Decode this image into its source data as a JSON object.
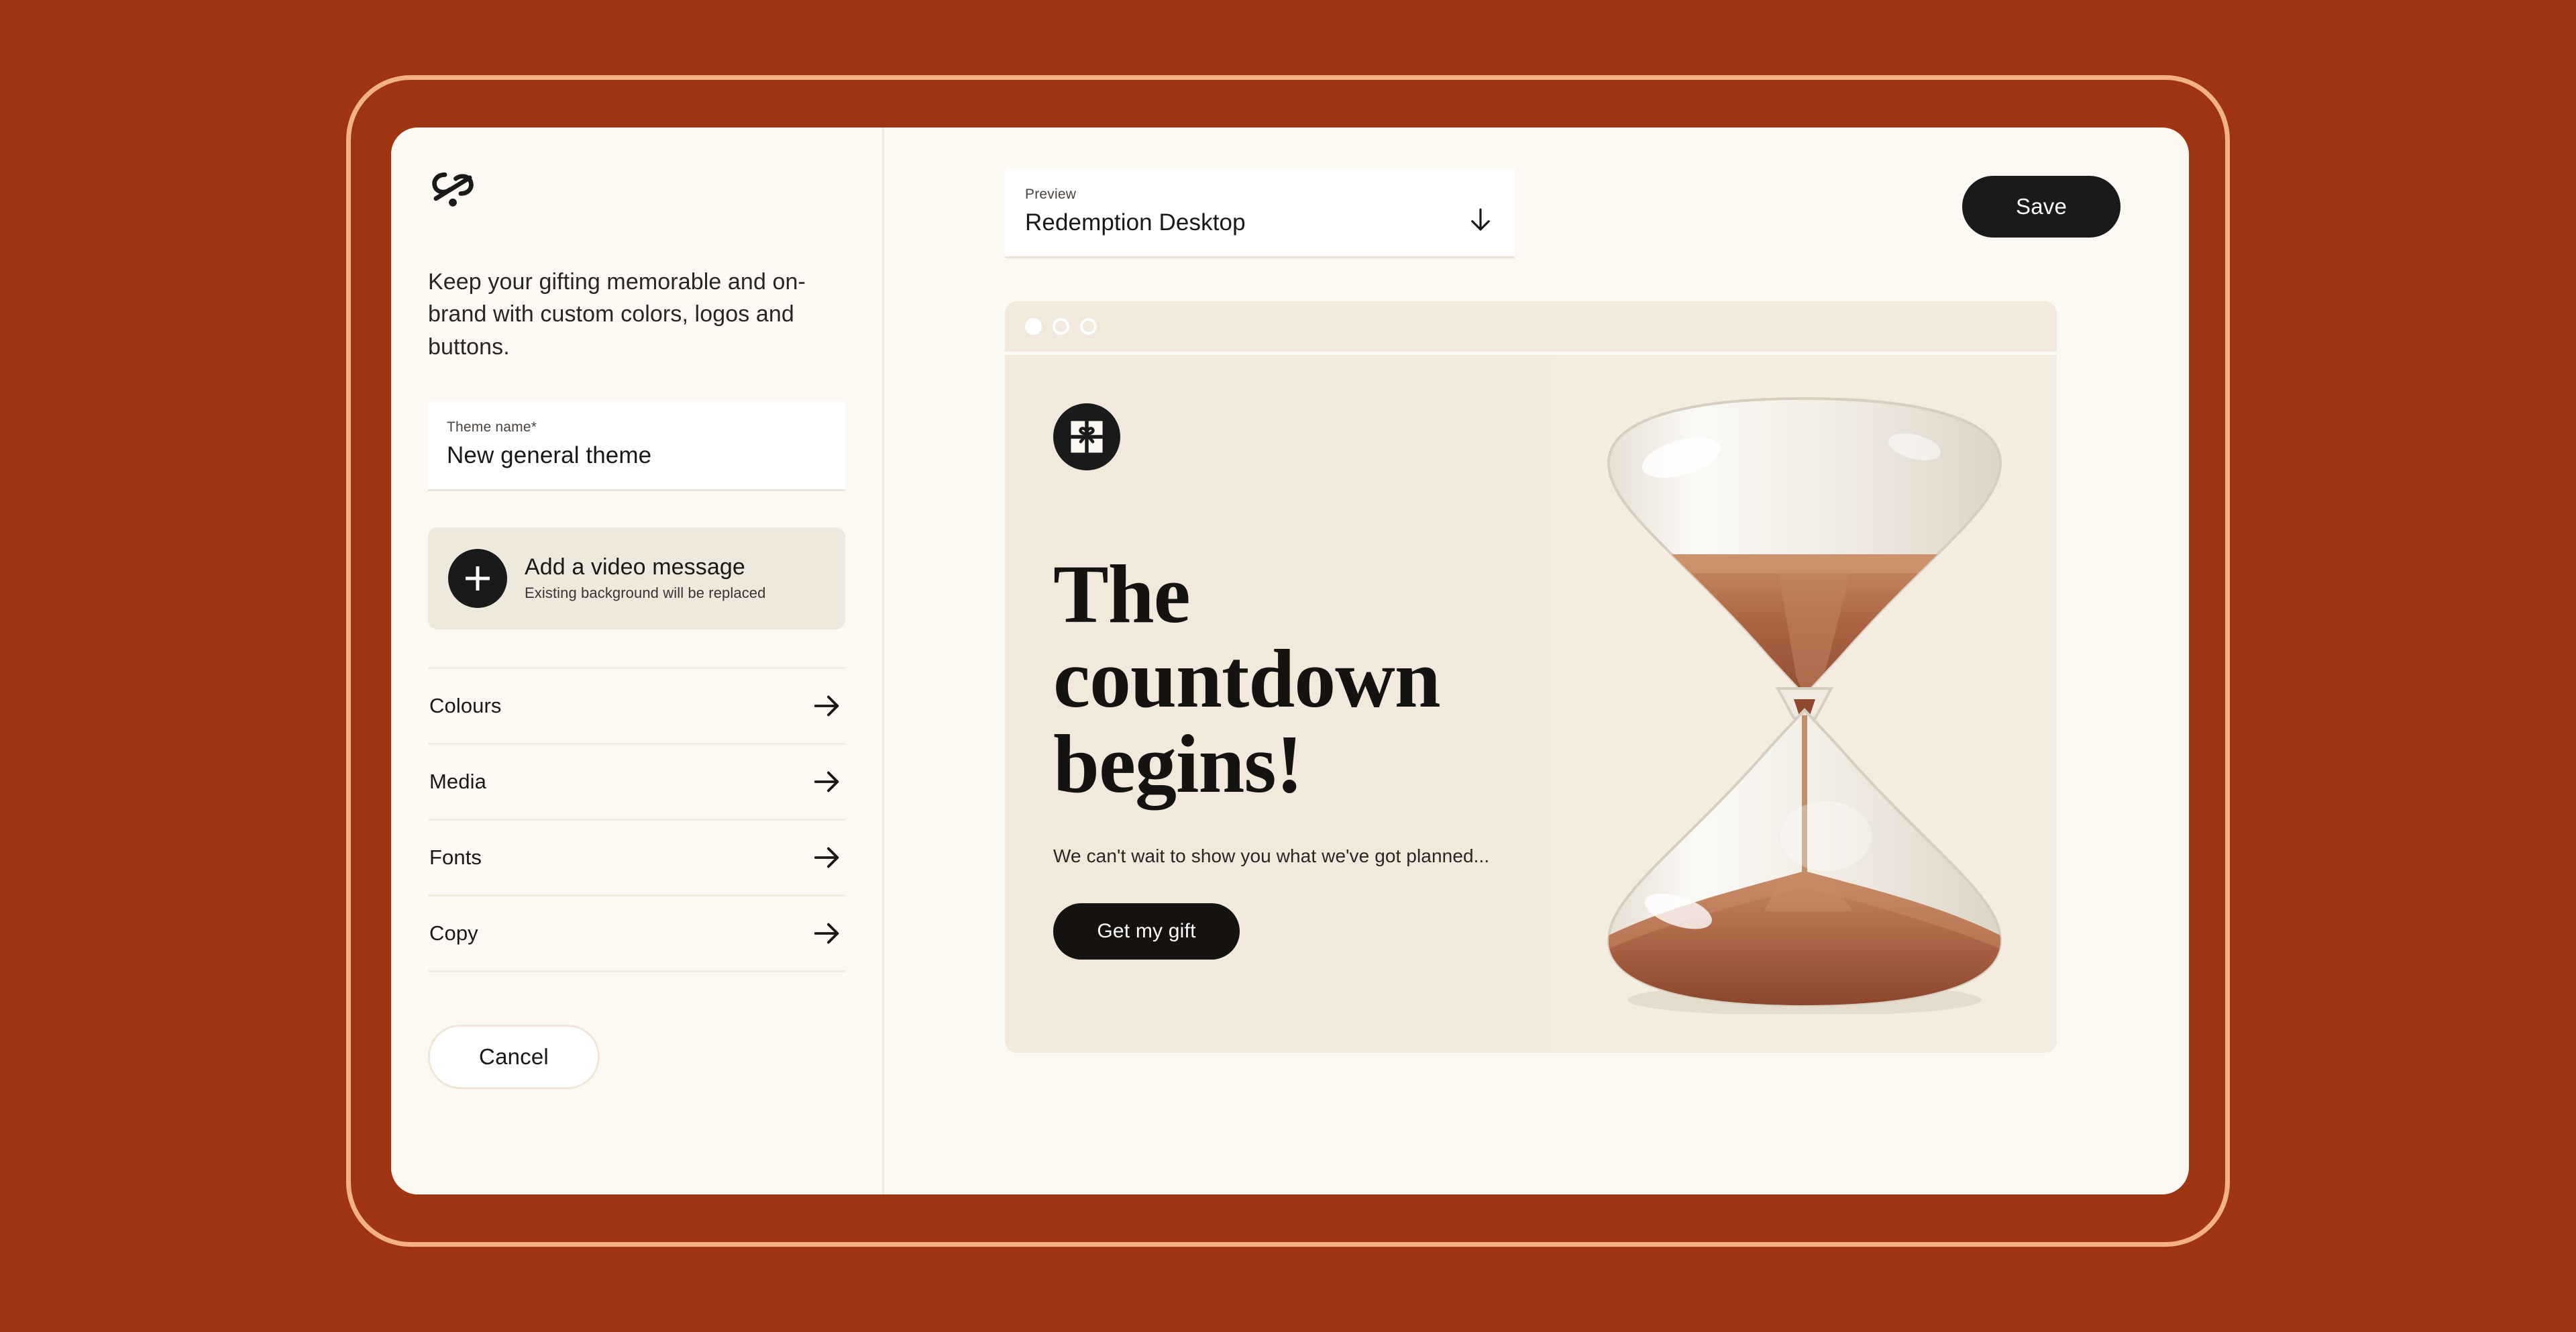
{
  "theme_colors": {
    "page_background": "#9E3411",
    "frame_border": "#F4B183",
    "card_background": "#FCF9F2",
    "accent_dark": "#1A1A1A",
    "preview_background": "#F2E9DC",
    "sand": "#B5724F"
  },
  "sidebar": {
    "brand_logo_icon": "ribbon-percent-logo-icon",
    "intro_text": "Keep your gifting memorable and on-brand with custom colors, logos and buttons.",
    "theme_name": {
      "label": "Theme name*",
      "value": "New general theme",
      "placeholder": "Theme name"
    },
    "video_message": {
      "plus_icon": "plus-icon",
      "title": "Add a video message",
      "subtitle": "Existing background will be replaced"
    },
    "menu_items": [
      {
        "label": "Colours",
        "arrow_icon": "arrow-right-icon"
      },
      {
        "label": "Media",
        "arrow_icon": "arrow-right-icon"
      },
      {
        "label": "Fonts",
        "arrow_icon": "arrow-right-icon"
      },
      {
        "label": "Copy",
        "arrow_icon": "arrow-right-icon"
      }
    ],
    "cancel_label": "Cancel"
  },
  "preview": {
    "selector": {
      "label": "Preview",
      "value": "Redemption Desktop",
      "arrow_icon": "arrow-down-icon"
    },
    "save_label": "Save",
    "browser_chrome": {
      "dots": [
        "filled",
        "outline",
        "outline"
      ]
    },
    "content": {
      "logo_icon": "gift-box-icon",
      "heading": "The countdown begins!",
      "subtext": "We can't wait to show you what we've got planned...",
      "cta_label": "Get my gift",
      "image_alt": "hourglass-with-copper-sand"
    }
  }
}
